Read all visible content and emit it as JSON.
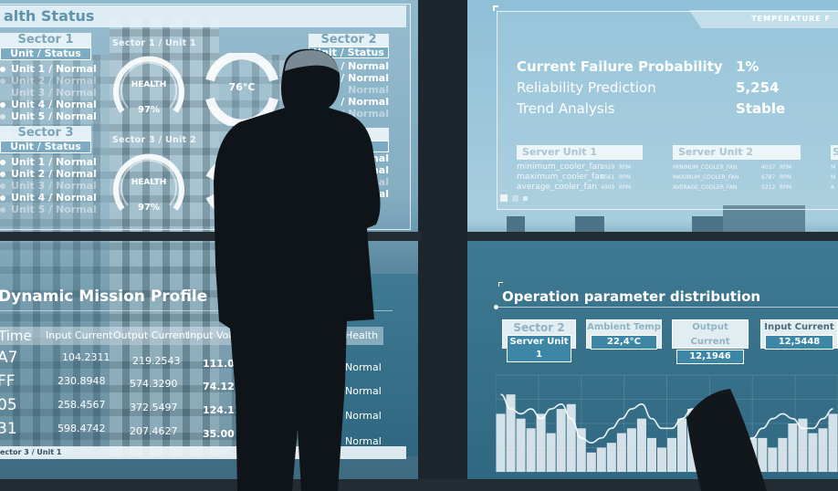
{
  "health_status": {
    "title": "alth Status",
    "sectors": [
      {
        "name": "Sector 1",
        "header": "Unit / Status",
        "units": [
          {
            "label": "Unit 1 / Normal",
            "dim": false
          },
          {
            "label": "Unit 2 / Normal",
            "dim": true
          },
          {
            "label": "Unit 3 / Normal",
            "dim": true
          },
          {
            "label": "Unit 4 / Normal",
            "dim": false
          },
          {
            "label": "Unit 5 / Normal",
            "dim": false
          }
        ]
      },
      {
        "name": "Sector 2",
        "header": "Unit / Status",
        "units": [
          {
            "label": "/ Normal",
            "dim": false
          },
          {
            "label": "/ Normal",
            "dim": false
          },
          {
            "label": "Normal",
            "dim": true
          },
          {
            "label": "/ Normal",
            "dim": false
          },
          {
            "label": "5 / Normal",
            "dim": true
          }
        ]
      },
      {
        "name": "Sector 3",
        "header": "Unit / Status",
        "units": [
          {
            "label": "Unit 1 / Normal",
            "dim": false
          },
          {
            "label": "Unit 2 / Normal",
            "dim": false
          },
          {
            "label": "Unit 3 / Normal",
            "dim": true
          },
          {
            "label": "Unit 4 / Normal",
            "dim": false
          },
          {
            "label": "Unit 5 / Normal",
            "dim": true
          }
        ]
      }
    ],
    "gauges": [
      {
        "caption": "Sector 1 / Unit 1",
        "label": "HEALTH",
        "value": "97%",
        "fraction": 0.97
      },
      {
        "caption": "Sector 3 / Unit 2",
        "label": "HEALTH",
        "value": "97%",
        "fraction": 0.97
      }
    ],
    "temperature_gauge": {
      "value": "76°C"
    },
    "partial_labels": [
      "nal",
      "mal",
      "nal",
      "mal",
      "nal"
    ]
  },
  "reliability": {
    "tab_label": "TEMPERATURE F",
    "metrics": [
      {
        "label": "Current Failure Probability",
        "value": "1%"
      },
      {
        "label": "Reliability Prediction",
        "value": "5,254"
      },
      {
        "label": "Trend Analysis",
        "value": "Stable"
      }
    ],
    "servers": [
      {
        "name": "Server Unit 1",
        "rows": [
          {
            "label": "minimum_cooler_fan",
            "value": "3929",
            "unit": "RPM"
          },
          {
            "label": "maximum_cooler_fan",
            "value": "6561",
            "unit": "RPM"
          },
          {
            "label": "average_cooler_fan",
            "value": "4909",
            "unit": "RPM"
          }
        ]
      },
      {
        "name": "Server Unit 2",
        "rows": [
          {
            "label": "MINIMUM_COOLER_FAN",
            "value": "4037",
            "unit": "RPM"
          },
          {
            "label": "MAXIMUM_COOLER_FAN",
            "value": "6787",
            "unit": "RPM"
          },
          {
            "label": "AVERAGE_COOLER_FAN",
            "value": "5212",
            "unit": "RPM"
          }
        ]
      },
      {
        "name": "S",
        "rows": [
          {
            "label": "M"
          },
          {
            "label": "M"
          },
          {
            "label": "A"
          }
        ]
      }
    ]
  },
  "mission_profile": {
    "title": "Dynamic Mission Profile",
    "columns": [
      "Time",
      "Input Current",
      "Output Current",
      "Input Volt",
      "Health"
    ],
    "rows": [
      {
        "time": "A7",
        "input_current": "104.2311",
        "output_current": "219.2543",
        "input_volt": "111.05",
        "health": "Normal"
      },
      {
        "time": "FF",
        "input_current": "230.8948",
        "output_current": "574.3290",
        "input_volt": "74.12",
        "health": "Normal"
      },
      {
        "time": "05",
        "input_current": "258.4567",
        "output_current": "372.5497",
        "input_volt": "124.11",
        "health": "Normal"
      },
      {
        "time": "31",
        "input_current": "598.4742",
        "output_current": "207.4627",
        "input_volt": "35.00",
        "health": "Normal"
      }
    ],
    "footer": "ector 3 / Unit 1"
  },
  "operation": {
    "title": "Operation parameter distribution",
    "params": [
      {
        "label": "Sector 2",
        "value": "Server Unit 1"
      },
      {
        "label": "Ambient Temp",
        "value": "22,4°C"
      },
      {
        "label": "Output Current",
        "value": "12,1946"
      },
      {
        "label": "Input Current",
        "value": "12,5448"
      }
    ]
  },
  "chart_data": {
    "type": "bar",
    "title": "",
    "xlabel": "",
    "ylabel": "",
    "ylim": [
      0,
      10
    ],
    "values": [
      6,
      8,
      5.5,
      4.5,
      6,
      4,
      6.5,
      7,
      4.5,
      2,
      2.5,
      3,
      4,
      4.5,
      5.5,
      3.5,
      2.5,
      3.5,
      5.5,
      6.5,
      6,
      2.5,
      2,
      2,
      3,
      3.5,
      3.5,
      2.5,
      3.5,
      5,
      5.5,
      4,
      4.5,
      6
    ],
    "line": [
      8,
      6.5,
      6,
      6.5,
      5.5,
      6.5,
      7,
      5.5,
      3.5,
      3,
      3.5,
      4.5,
      5.5,
      6.5,
      7,
      5.5,
      4.5,
      4.5,
      5.5,
      6.5,
      6.5,
      5,
      3.5,
      3,
      3,
      3.5,
      4.5,
      5.5,
      6,
      5.5,
      4.5,
      4.5,
      5.5,
      6.5
    ],
    "grid": true
  }
}
